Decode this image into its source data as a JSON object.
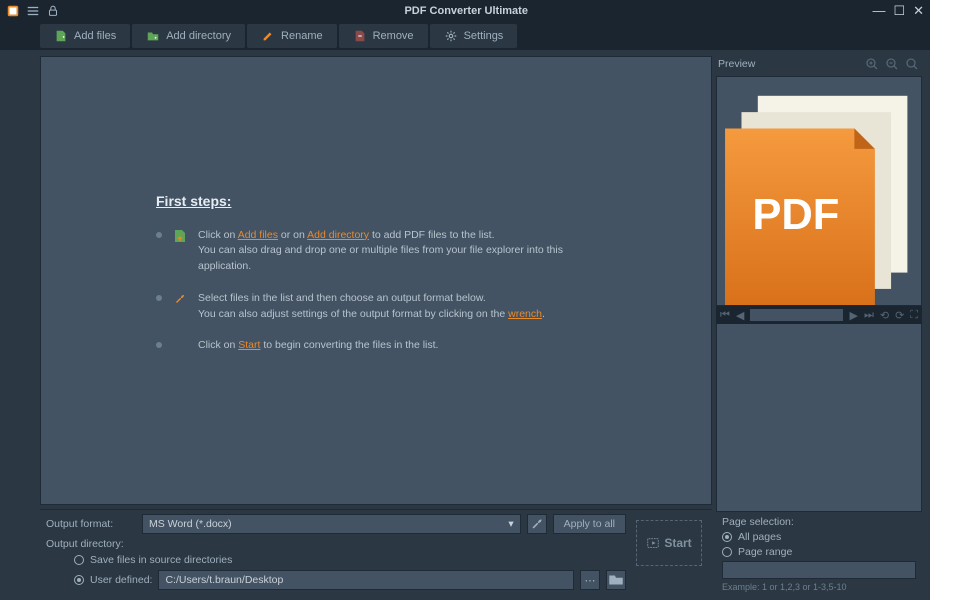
{
  "titlebar": {
    "title": "PDF Converter Ultimate"
  },
  "toolbar": {
    "add_files": "Add files",
    "add_directory": "Add directory",
    "rename": "Rename",
    "remove": "Remove",
    "settings": "Settings"
  },
  "firststeps": {
    "heading": "First steps:",
    "s1a": "Click on ",
    "s1_link1": "Add files",
    "s1b": " or on ",
    "s1_link2": "Add directory",
    "s1c": " to add PDF files to the list.",
    "s1d": "You can also drag and drop one or multiple files from your file explorer into this application.",
    "s2a": "Select files in the list and then choose an output format below.",
    "s2b_pre": "You can also adjust settings of the output format by clicking on the ",
    "s2_link": "wrench",
    "s2b_post": ".",
    "s3a": "Click on ",
    "s3_link": "Start",
    "s3b": " to begin converting the files in the list."
  },
  "bottom": {
    "output_format_label": "Output format:",
    "output_format_value": "MS Word (*.docx)",
    "apply_all": "Apply to all",
    "output_directory_label": "Output directory:",
    "save_source": "Save files in source directories",
    "user_defined_label": "User defined:",
    "user_defined_value": "C:/Users/t.braun/Desktop",
    "start": "Start"
  },
  "preview": {
    "label": "Preview",
    "pdf_badge": "PDF"
  },
  "pagesel": {
    "heading": "Page selection:",
    "all_pages": "All pages",
    "page_range": "Page range",
    "example": "Example: 1 or 1,2,3 or 1-3,5-10"
  }
}
